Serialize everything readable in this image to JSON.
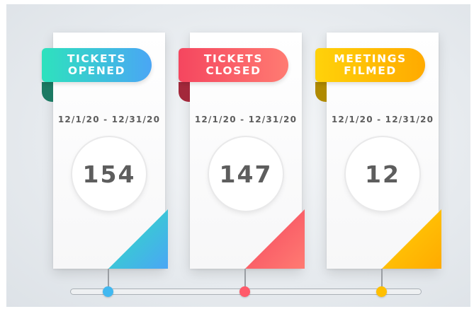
{
  "cards": [
    {
      "title_line1": "TICKETS",
      "title_line2": "OPENED",
      "date_range": "12/1/20 - 12/31/20",
      "value": "154",
      "color_from": "#2ee2bd",
      "color_to": "#4aa6f5",
      "fold_color": "#1c7a63"
    },
    {
      "title_line1": "TICKETS",
      "title_line2": "CLOSED",
      "date_range": "12/1/20 - 12/31/20",
      "value": "147",
      "color_from": "#f5465f",
      "color_to": "#ff7b72",
      "fold_color": "#a3283b"
    },
    {
      "title_line1": "MEETINGS",
      "title_line2": "FILMED",
      "date_range": "12/1/20 - 12/31/20",
      "value": "12",
      "color_from": "#ffd20a",
      "color_to": "#ffaa00",
      "fold_color": "#b08a00"
    }
  ],
  "timeline": {
    "dot_colors": [
      "#41b8f0",
      "#ff5a6a",
      "#ffbf00"
    ]
  }
}
